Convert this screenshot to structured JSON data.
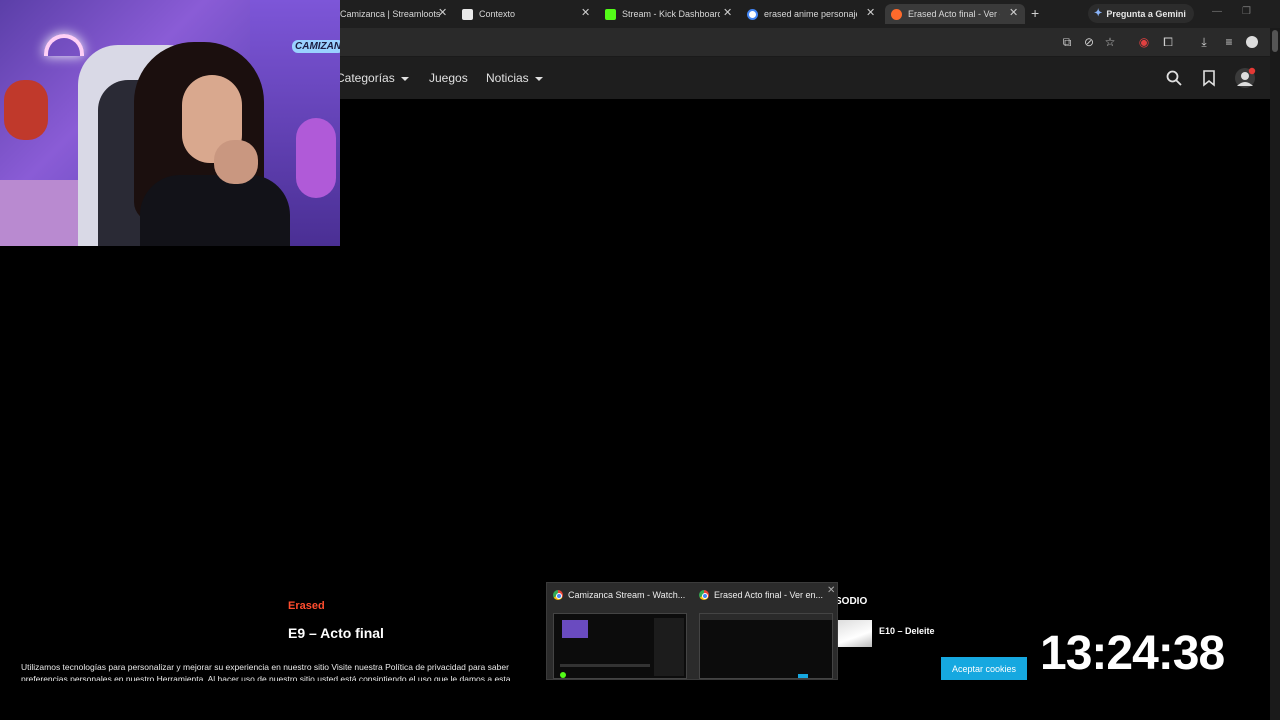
{
  "browser": {
    "tabs": [
      {
        "title": "Camizanca | Streamloots |",
        "favicon": "#a0a0a0",
        "active": false
      },
      {
        "title": "Contexto",
        "favicon": "#e8e8e8",
        "active": false
      },
      {
        "title": "Stream - Kick Dashboard",
        "favicon": "#53fc18",
        "active": false
      },
      {
        "title": "erased anime personajes -",
        "favicon": "#4285f4",
        "active": false
      },
      {
        "title": "Erased Acto final - Ver en C",
        "favicon": "#ff6a2b",
        "active": true
      }
    ],
    "close_glyph": "✕",
    "new_tab_glyph": "+",
    "gemini_label": "Pregunta a Gemini",
    "window_controls": [
      "—",
      "❐"
    ]
  },
  "toolbar": {
    "icons": [
      "install-icon",
      "eye-off-icon",
      "star-icon",
      "extension-red-icon",
      "puzzle-icon",
      "download-icon",
      "media-icon",
      "profile-icon"
    ]
  },
  "site_nav": {
    "items": [
      {
        "label": "Categorías",
        "dropdown": true
      },
      {
        "label": "Juegos",
        "dropdown": false
      },
      {
        "label": "Noticias",
        "dropdown": true
      }
    ]
  },
  "webcam": {
    "logo_text": "CAMIZAN"
  },
  "episode": {
    "series": "Erased",
    "title": "E9 – Acto final"
  },
  "next_episode": {
    "header": "SODIO",
    "title": "E10 – Deleite"
  },
  "cookie_banner": {
    "text": "Utilizamos tecnologías para personalizar y mejorar su experiencia en nuestro sitio Visite nuestra Política de privacidad para saber preferencias personales en nuestro Herramienta. Al hacer uso de nuestro sitio usted está consintiendo el uso que le damos a esta",
    "accept_label": "Aceptar cookies",
    "accent": "#16a8e0"
  },
  "clock": "13:24:38",
  "taskbar_preview": {
    "items": [
      {
        "title": "Camizanca Stream - Watch..."
      },
      {
        "title": "Erased Acto final - Ver en..."
      }
    ],
    "close_glyph": "✕"
  },
  "colors": {
    "accent_series": "#ff4d2e",
    "page_bg": "#000000",
    "nav_bg": "#1e1e1e"
  }
}
